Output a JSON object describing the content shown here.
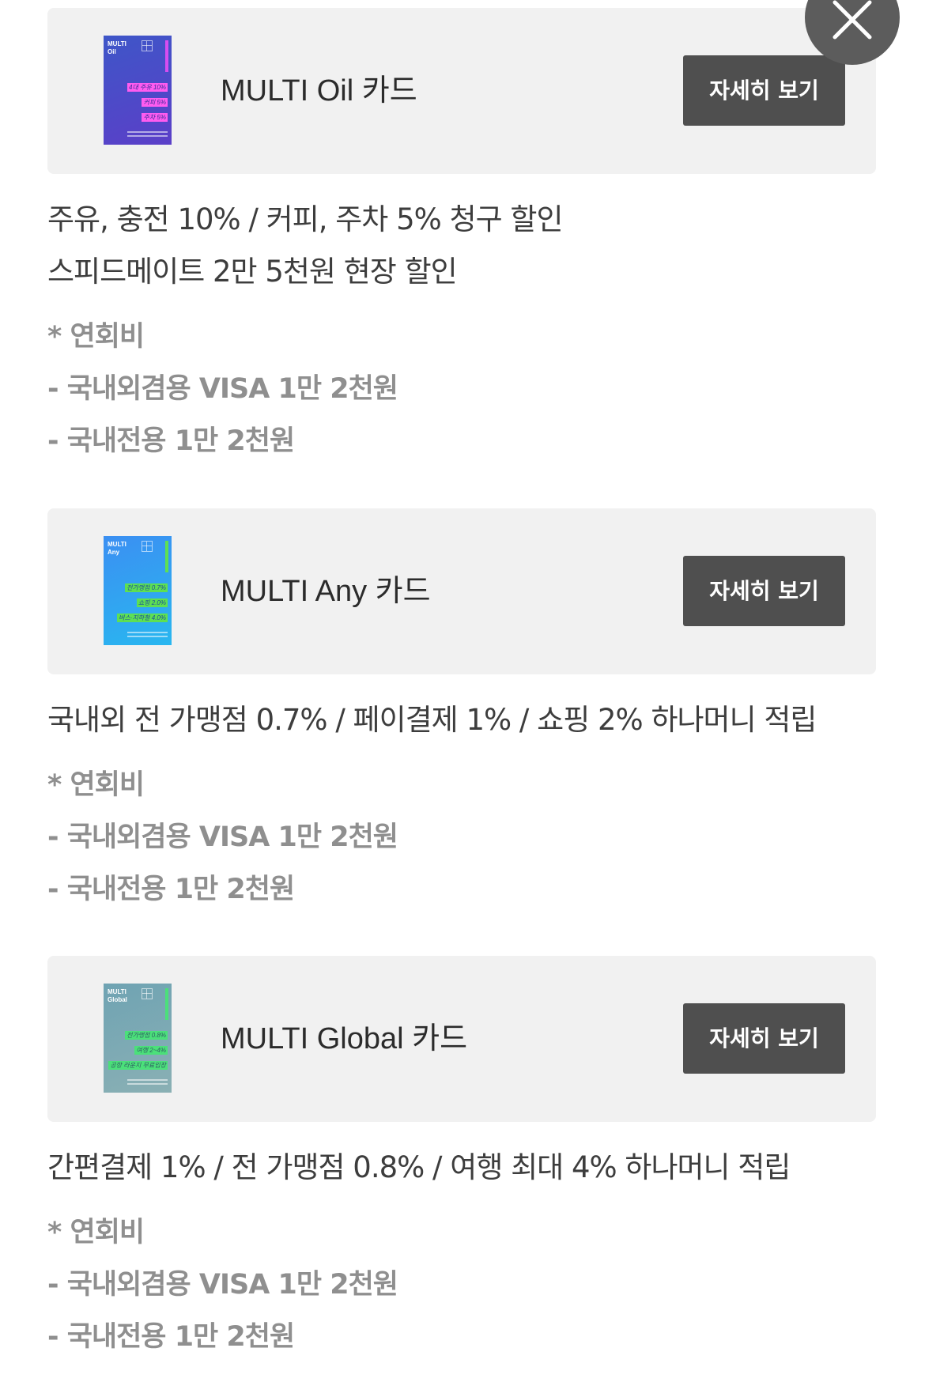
{
  "close_label": "×",
  "cards": [
    {
      "thumb": {
        "brand_line1": "MULTI",
        "brand_line2": "Oil",
        "bg": "#3e56c8",
        "bg2": "#5b3fc8",
        "accent": "#ff5cf0",
        "stripe": "#d64df0",
        "lines": [
          "4대 주유 10%",
          "커피 5%",
          "주차 5%"
        ]
      },
      "name": "MULTI Oil 카드",
      "button_label": "자세히 보기",
      "benefits": [
        "주유, 충전 10% / 커피, 주차 5% 청구 할인",
        "스피드메이트 2만 5천원 현장 할인"
      ],
      "fees": [
        "* 연회비",
        "- 국내외겸용 VISA 1만 2천원",
        "- 국내전용 1만 2천원"
      ]
    },
    {
      "thumb": {
        "brand_line1": "MULTI",
        "brand_line2": "Any",
        "bg": "#3b8ff2",
        "bg2": "#29b7f0",
        "accent": "#5ee052",
        "stripe": "#5ee052",
        "lines": [
          "전가맹점 0.7%",
          "쇼핑 2.0%",
          "버스·지하철 4.0%"
        ]
      },
      "name": "MULTI Any 카드",
      "button_label": "자세히 보기",
      "benefits": [
        "국내외 전 가맹점 0.7% / 페이결제 1% / 쇼핑 2% 하나머니 적립"
      ],
      "fees": [
        "* 연회비",
        "- 국내외겸용 VISA 1만 2천원",
        "- 국내전용 1만 2천원"
      ]
    },
    {
      "thumb": {
        "brand_line1": "MULTI",
        "brand_line2": "Global",
        "bg": "#6fa3b3",
        "bg2": "#8ab0b4",
        "accent": "#4be07a",
        "stripe": "#4be07a",
        "lines": [
          "전가맹점 0.8%",
          "여행 2~4%",
          "공항 라운지 무료입장"
        ]
      },
      "name": "MULTI Global 카드",
      "button_label": "자세히 보기",
      "benefits": [
        "간편결제 1% / 전 가맹점 0.8% / 여행 최대 4% 하나머니 적립"
      ],
      "fees": [
        "* 연회비",
        "- 국내외겸용 VISA 1만 2천원",
        "- 국내전용 1만 2천원"
      ]
    }
  ]
}
